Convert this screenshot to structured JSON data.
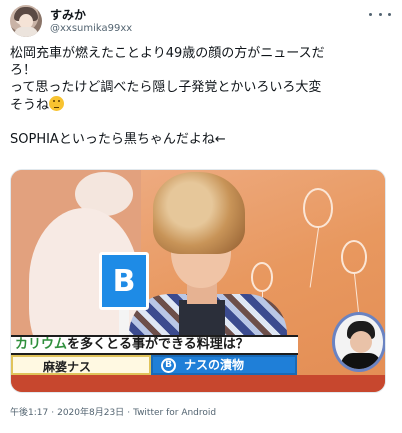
{
  "tweet": {
    "author": {
      "display_name": "すみか",
      "handle": "@xxsumika99xx",
      "avatar_icon": "avatar-photo"
    },
    "text_lines": [
      "松岡充車が燃えたことより49歳の顔の方がニュースだ",
      "ろ！",
      "って思ったけど調べたら隠し子発覚とかいろいろ大変",
      "そうね"
    ],
    "text_lines_last": "SOPHIAといったら黒ちゃんだよね←",
    "emoji": "thinking-face-emoji",
    "more_icon": "more-icon",
    "media": {
      "caption_highlight": "カリウム",
      "caption_rest": "を多くとる事ができる料理は？",
      "option_a": "麻婆ナス",
      "option_b_badge": "B",
      "option_b": "ナスの漬物",
      "board_letter": "B"
    },
    "meta": {
      "time": "午後1:17",
      "separator": "·",
      "date": "2020年8月23日",
      "source": "Twitter for Android"
    }
  },
  "colors": {
    "text": "#0f1419",
    "secondary": "#536471",
    "board_blue": "#1e8be6",
    "caption_green": "#2f8f3c",
    "caption_red": "#c7472e",
    "background_orange": "#e8985f"
  }
}
